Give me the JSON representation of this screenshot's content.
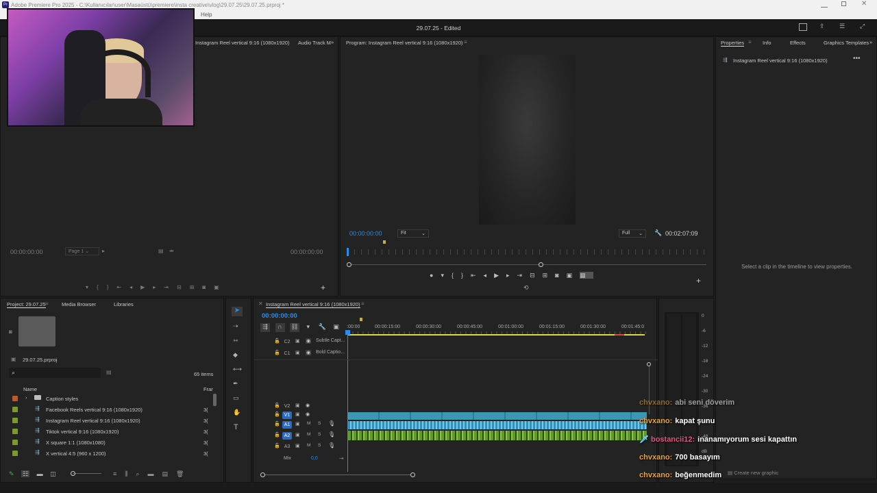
{
  "window": {
    "title": "Adobe Premiere Pro 2025 - C:\\Kullanıcılar\\user\\Masaüstü\\premiere\\insta creative\\vlog\\29.07.25\\29.07.25.prproj *",
    "menu_help": "Help",
    "project_status": "29.07.25 - Edited"
  },
  "source_panel": {
    "tab_audio_track": "Audio Track M",
    "tab_instagram": "Instagram Reel vertical 9:16 (1080x1920)",
    "timecode_left": "00:00:00:00",
    "page_select": "Page 1",
    "timecode_right": "00:00:00:00"
  },
  "program_monitor": {
    "title": "Program: Instagram Reel vertical 9:16 (1080x1920)",
    "timecode": "00:00:00:00",
    "fit_select": "Fit",
    "quality_select": "Full",
    "duration": "00:02:07:09"
  },
  "properties_panel": {
    "tabs": [
      "Properties",
      "Info",
      "Effects",
      "Graphics Templates"
    ],
    "sequence_name": "Instagram Reel vertical 9:16 (1080x1920)",
    "empty_message": "Select a clip in the timeline to view properties."
  },
  "project_panel": {
    "tabs": [
      "Project: 29.07.25",
      "Media Browser",
      "Libraries"
    ],
    "file_name": "29.07.25.prproj",
    "items_count": "65 items",
    "col_name": "Name",
    "col_frame": "Frar",
    "rows": [
      {
        "name": "Caption styles",
        "color": "#c0582b",
        "kind": "folder",
        "fr": ""
      },
      {
        "name": "Facebook Reels vertical 9:16 (1080x1920)",
        "color": "#7a9a2b",
        "kind": "seq",
        "fr": "3("
      },
      {
        "name": "Instagram Reel vertical 9:16 (1080x1920)",
        "color": "#7a9a2b",
        "kind": "seq",
        "fr": "3("
      },
      {
        "name": "Tiktok vertical 9:16 (1080x1920)",
        "color": "#7a9a2b",
        "kind": "seq",
        "fr": "3("
      },
      {
        "name": "X square 1:1 (1080x1080)",
        "color": "#7a9a2b",
        "kind": "seq",
        "fr": "3("
      },
      {
        "name": "X vertical 4:5 (960 x 1200)",
        "color": "#7a9a2b",
        "kind": "seq",
        "fr": "3("
      }
    ]
  },
  "timeline": {
    "sequence_tab": "Instagram Reel vertical 9:16 (1080x1920)",
    "timecode": "00:00:00:00",
    "ruler": [
      ":00:00",
      "00:00:15:00",
      "00:00:30:00",
      "00:00:45:00",
      "00:01:00:00",
      "00:01:15:00",
      "00:01:30:00",
      "00:01:45:0"
    ],
    "caption_tracks": [
      {
        "id": "C2",
        "label": "Subtle Capt..."
      },
      {
        "id": "C1",
        "label": "Bold Captio..."
      }
    ],
    "video_tracks": [
      "V2",
      "V1"
    ],
    "audio_tracks": [
      "A1",
      "A2",
      "A3"
    ],
    "mix_label": "Mix",
    "mix_value": "0,0",
    "m_label": "M",
    "s_label": "S"
  },
  "audio_meter": {
    "scale": [
      "0",
      "-6",
      "-12",
      "-18",
      "-24",
      "-30",
      "-36",
      "-42",
      "-48",
      "dB"
    ]
  },
  "essential_graphics": {
    "create_new": "Create new graphic"
  },
  "chat": [
    {
      "user": "chvxano:",
      "message": "abi seni döverim",
      "user_color": "#e8a33a",
      "faded": true
    },
    {
      "user": "chvxano:",
      "message": "kapat şunu",
      "user_color": "#e8a33a",
      "faded": false
    },
    {
      "user": "bostancii12:",
      "message": "inanamıyorum sesi kapattın",
      "user_color": "#e0567f",
      "faded": false
    },
    {
      "user": "chvxano:",
      "message": "700 basayım",
      "user_color": "#e8a33a",
      "faded": false
    },
    {
      "user": "chvxano:",
      "message": "beğenmedim",
      "user_color": "#e8a33a",
      "faded": false
    }
  ]
}
